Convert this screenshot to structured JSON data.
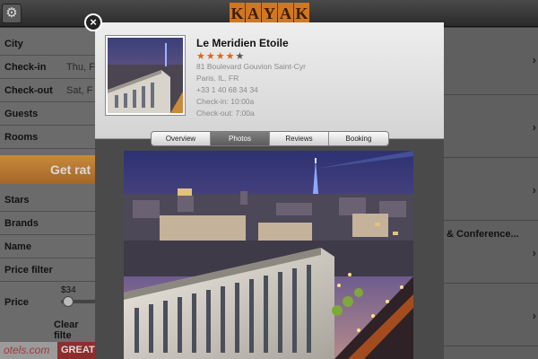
{
  "topbar": {
    "settings_icon": "gear-icon",
    "logo_letters": [
      "K",
      "A",
      "Y",
      "A",
      "K"
    ]
  },
  "left_form": {
    "fields": [
      {
        "label": "City",
        "value": ""
      },
      {
        "label": "Check-in",
        "value": "Thu, F"
      },
      {
        "label": "Check-out",
        "value": "Sat, F"
      },
      {
        "label": "Guests",
        "value": ""
      },
      {
        "label": "Rooms",
        "value": ""
      }
    ],
    "get_rates": "Get rat",
    "filters": [
      {
        "label": "Stars",
        "value": ""
      },
      {
        "label": "Brands",
        "value": ""
      },
      {
        "label": "Name",
        "value": ""
      },
      {
        "label": "Price filter",
        "value": ""
      },
      {
        "label": "Price",
        "value": ""
      }
    ],
    "price_min": "$34",
    "clear": "Clear filte",
    "ad_left": "otels.com",
    "ad_right": "GREAT"
  },
  "right_list": {
    "visible_text": "& Conference...",
    "chevron": "›"
  },
  "popup": {
    "close_icon": "close-icon",
    "hotel_name": "Le Meridien Etoile",
    "stars_filled": 4,
    "stars_total": 5,
    "address": "81 Boulevard Gouvion Saint-Cyr",
    "city": "Paris, IL, FR",
    "phone": "+33 1 40 68 34 34",
    "checkin": "Check-in: 10:00a",
    "checkout": "Check-out: 7:00a",
    "tabs": [
      {
        "label": "Overview",
        "active": false
      },
      {
        "label": "Photos",
        "active": true
      },
      {
        "label": "Reviews",
        "active": false
      },
      {
        "label": "Booking",
        "active": false
      }
    ]
  },
  "colors": {
    "accent": "#d2761f",
    "star": "#d9641e",
    "active_tab": "#6b6b6b"
  }
}
